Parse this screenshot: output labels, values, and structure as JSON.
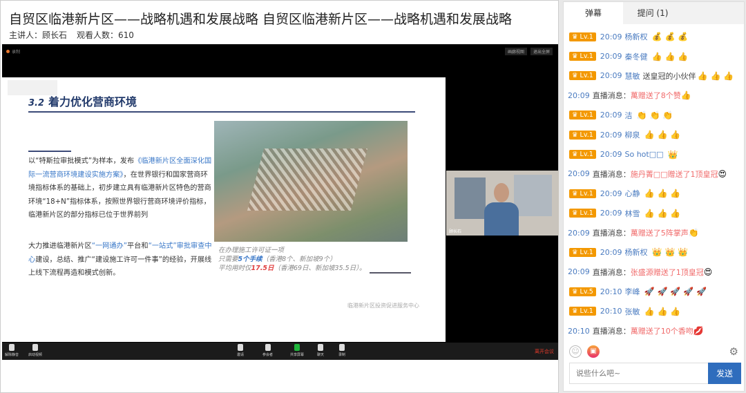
{
  "header": {
    "title": "自贸区临港新片区——战略机遇和发展战略  自贸区临港新片区——战略机遇和发展战略",
    "speaker": "主讲人：顾长石",
    "viewers": "观看人数：610"
  },
  "video": {
    "recording_label": "录制",
    "top_buttons": [
      "画廊视图",
      "退出全屏"
    ],
    "slide": {
      "number": "3.2",
      "title": "着力优化营商环境",
      "para1": [
        "以“特斯拉审批模式”为样本，发布",
        "《临港新片区全面深化国际一流营商环境建设实施方案》",
        "，在世界银行和国家营商环境指标体系的基础上，初步建立具有临港新片区特色的营商环境“18+N”指标体系，按照世界银行营商环境评价指标，临港新片区的部分指标已位于世界前列"
      ],
      "para2": [
        "大力推进临港新片区",
        "“一网通办”",
        "平台和",
        "“一站式”审批审查中心",
        "建设，总结、推广“建设施工许可一件事”的经验，开展线上线下流程再造和模式创新。"
      ],
      "caption": [
        "在办理施工许可证一项",
        "只需要",
        "5个手续",
        "（香港8个、新加坡9个）",
        "平均用时仅",
        "17.5日",
        "（香港69日、新加坡35.5日）。"
      ],
      "org": "临港新片区投资促进服务中心"
    },
    "camera_name": "顾长石",
    "toolbar": [
      "解除静音",
      "启动视频",
      "邀请",
      "参会者",
      "共享屏幕",
      "聊天",
      "录制"
    ],
    "leave": "离开会议"
  },
  "chat": {
    "tabs": [
      "弹幕",
      "提问 (1)"
    ],
    "messages": [
      {
        "type": "user",
        "lv": "Lv.1",
        "time": "20:09",
        "user": "杨新权",
        "text": "",
        "emoji": "💰💰💰"
      },
      {
        "type": "user",
        "lv": "Lv.1",
        "time": "20:09",
        "user": "秦冬健",
        "text": "",
        "emoji": "👍👍👍"
      },
      {
        "type": "user",
        "lv": "Lv.1",
        "time": "20:09",
        "user": "慧敏",
        "text": "送皇冠的小伙伴",
        "emoji": "👍👍👍"
      },
      {
        "type": "sys",
        "time": "20:09",
        "label": "直播消息：",
        "text": "萬赠送了8个赞",
        "emoji": "👍"
      },
      {
        "type": "user",
        "lv": "Lv.1",
        "time": "20:09",
        "user": "洁",
        "text": "",
        "emoji": "👏👏👏"
      },
      {
        "type": "user",
        "lv": "Lv.1",
        "time": "20:09",
        "user": "柳泉",
        "text": "",
        "emoji": "👍👍👍"
      },
      {
        "type": "user",
        "lv": "Lv.1",
        "time": "20:09",
        "user": "So hot□□",
        "text": "",
        "emoji": "👑"
      },
      {
        "type": "sys",
        "time": "20:09",
        "label": "直播消息：",
        "text": "施丹菁□□赠送了1顶皇冠",
        "emoji": "😍"
      },
      {
        "type": "user",
        "lv": "Lv.1",
        "time": "20:09",
        "user": "心静",
        "text": "",
        "emoji": "👍👍👍"
      },
      {
        "type": "user",
        "lv": "Lv.1",
        "time": "20:09",
        "user": "林雪",
        "text": "",
        "emoji": "👍👍👍"
      },
      {
        "type": "sys",
        "time": "20:09",
        "label": "直播消息：",
        "text": "萬赠送了5阵掌声",
        "emoji": "👏"
      },
      {
        "type": "user",
        "lv": "Lv.1",
        "time": "20:09",
        "user": "杨新权",
        "text": "",
        "emoji": "👑👑👑"
      },
      {
        "type": "sys",
        "time": "20:09",
        "label": "直播消息：",
        "text": "张盛源赠送了1顶皇冠",
        "emoji": "😍"
      },
      {
        "type": "user",
        "lv": "Lv.5",
        "time": "20:10",
        "user": "李峰",
        "text": "",
        "emoji": "🚀🚀🚀🚀🚀"
      },
      {
        "type": "user",
        "lv": "Lv.1",
        "time": "20:10",
        "user": "张敏",
        "text": "",
        "emoji": "👍👍👍"
      },
      {
        "type": "sys",
        "time": "20:10",
        "label": "直播消息：",
        "text": "萬赠送了10个香吻",
        "emoji": "💋"
      }
    ],
    "input_placeholder": "说些什么吧~",
    "send": "发送"
  }
}
